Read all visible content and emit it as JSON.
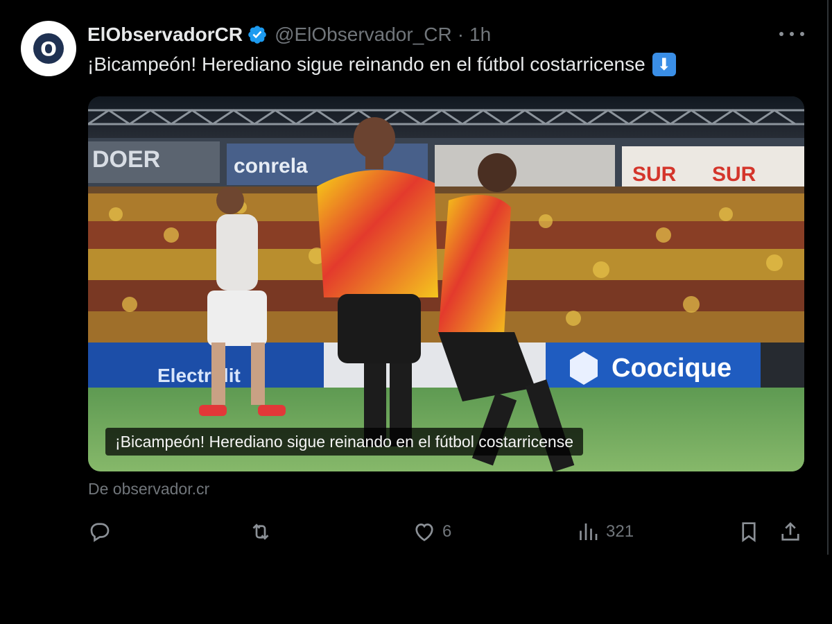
{
  "tweet": {
    "avatar_letter": "O",
    "display_name": "ElObservadorCR",
    "handle": "@ElObservador_CR",
    "separator": "·",
    "time": "1h",
    "text": "¡Bicampeón! Herediano sigue reinando en el fútbol costarricense",
    "emoji": "⬇"
  },
  "card": {
    "caption": "¡Bicampeón! Herediano sigue reinando en el fútbol costarricense",
    "source": "De observador.cr",
    "banner_texts": [
      "DOER",
      "conrela",
      "SUR",
      "SUR",
      "Coocique",
      "Electrolit"
    ]
  },
  "actions": {
    "reply_count": "",
    "retweet_count": "",
    "like_count": "6",
    "views_count": "321"
  },
  "colors": {
    "background": "#000000",
    "text_primary": "#e7e9ea",
    "text_secondary": "#71767b",
    "verified": "#1d9bf0"
  }
}
